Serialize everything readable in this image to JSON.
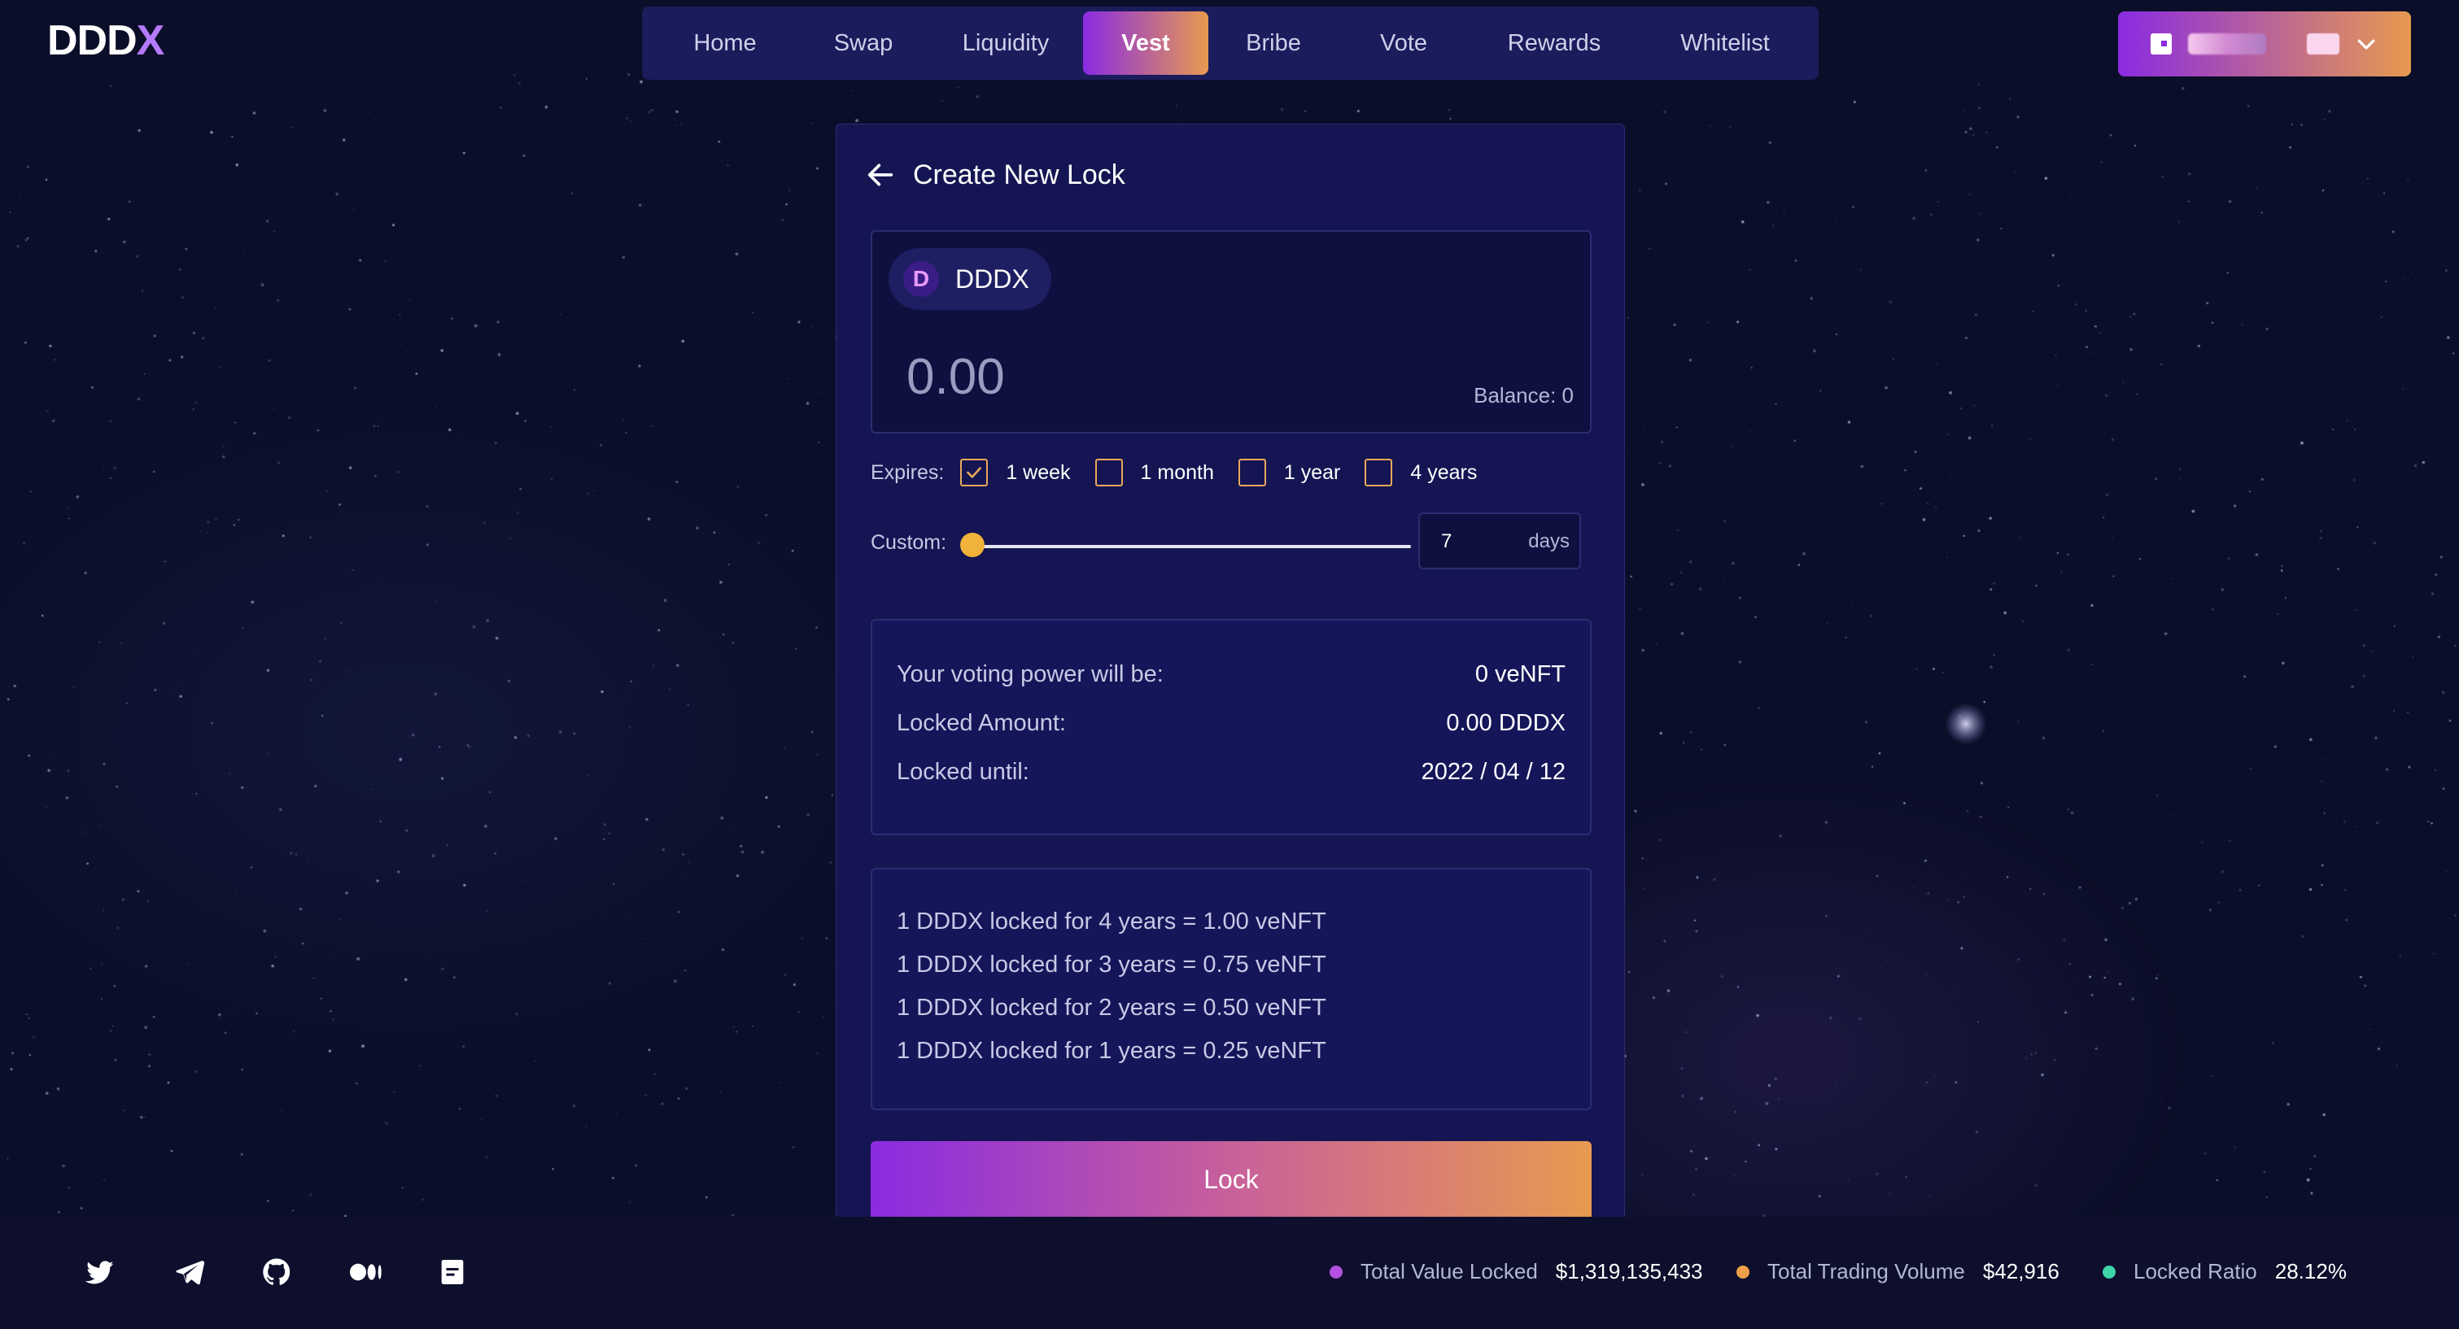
{
  "brand": {
    "logo_main": "DDD",
    "logo_accent": "X"
  },
  "nav": {
    "items": [
      {
        "label": "Home",
        "active": false
      },
      {
        "label": "Swap",
        "active": false
      },
      {
        "label": "Liquidity",
        "active": false
      },
      {
        "label": "Vest",
        "active": true
      },
      {
        "label": "Bribe",
        "active": false
      },
      {
        "label": "Vote",
        "active": false
      },
      {
        "label": "Rewards",
        "active": false
      },
      {
        "label": "Whitelist",
        "active": false
      }
    ]
  },
  "wallet": {
    "icon": "wallet-icon",
    "address_redacted": true,
    "dropdown_icon": "chevron-down-icon"
  },
  "lock_form": {
    "title": "Create New Lock",
    "back_icon": "arrow-left-icon",
    "token": {
      "symbol": "DDDX",
      "logo_letter": "D"
    },
    "amount_placeholder": "0.00",
    "balance": "Balance: 0",
    "expires_label": "Expires:",
    "expires_options": [
      {
        "label": "1 week",
        "checked": true
      },
      {
        "label": "1 month",
        "checked": false
      },
      {
        "label": "1 year",
        "checked": false
      },
      {
        "label": "4 years",
        "checked": false
      }
    ],
    "custom_label": "Custom:",
    "custom_slider_fraction": 0,
    "custom_days_value": "7",
    "custom_days_unit": "days",
    "summary": [
      {
        "label": "Your voting power will be:",
        "value": "0 veNFT"
      },
      {
        "label": "Locked Amount:",
        "value": "0.00 DDDX"
      },
      {
        "label": "Locked until:",
        "value": "2022 / 04 / 12"
      }
    ],
    "rates": [
      "1 DDDX locked for 4 years = 1.00 veNFT",
      "1 DDDX locked for 3 years = 0.75 veNFT",
      "1 DDDX locked for 2 years = 0.50 veNFT",
      "1 DDDX locked for 1 years = 0.25 veNFT"
    ],
    "submit_label": "Lock"
  },
  "footer": {
    "social_icons": [
      "twitter-icon",
      "telegram-icon",
      "github-icon",
      "medium-icon",
      "docs-icon"
    ],
    "stats": [
      {
        "label": "Total Value Locked",
        "value": "$1,319,135,433",
        "color": "#b44fe0"
      },
      {
        "label": "Total Trading Volume",
        "value": "$42,916",
        "color": "#f0a04a"
      },
      {
        "label": "Locked Ratio",
        "value": "28.12%",
        "color": "#3ed6a8"
      }
    ]
  },
  "colors": {
    "accent_start": "#8a2be2",
    "accent_end": "#e79a50",
    "checkbox": "#e8a85a",
    "slider_thumb": "#f0b23a"
  }
}
